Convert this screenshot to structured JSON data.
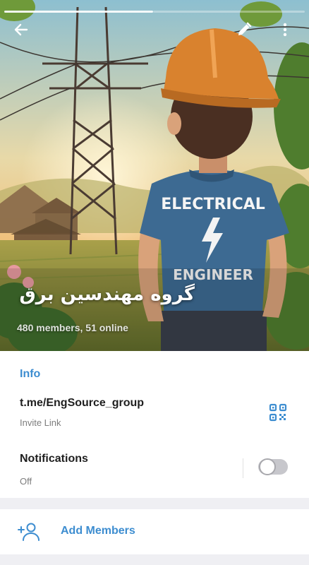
{
  "hero": {
    "title": "گروه مهندسین برق",
    "subtitle": "480 members, 51 online",
    "shirt_line1": "ELECTRICAL",
    "shirt_line2": "ENGINEER"
  },
  "icons": {
    "back": "arrow-left",
    "edit": "pencil",
    "more": "more-vertical",
    "qr": "qr-code",
    "add_members": "person-plus"
  },
  "info": {
    "heading": "Info",
    "link": "t.me/EngSource_group",
    "link_caption": "Invite Link",
    "notifications_label": "Notifications",
    "notifications_state": "Off",
    "notifications_on": false
  },
  "actions": {
    "add_members": "Add Members"
  },
  "colors": {
    "accent": "#3d8dd0",
    "text": "#1f1f1f",
    "muted": "#7d7d7d",
    "background": "#efeff3"
  }
}
